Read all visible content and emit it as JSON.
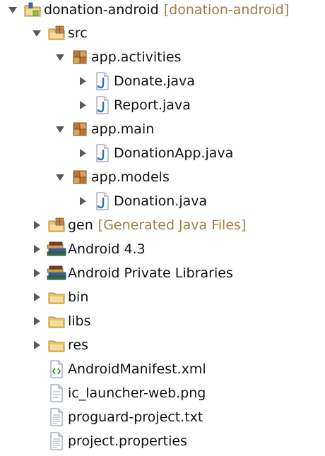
{
  "tree": {
    "project": {
      "label": "donation-android",
      "decoration": "[donation-android]"
    },
    "src": {
      "label": "src"
    },
    "pkg_activities": {
      "label": "app.activities"
    },
    "file_donate": {
      "label": "Donate.java"
    },
    "file_report": {
      "label": "Report.java"
    },
    "pkg_main": {
      "label": "app.main"
    },
    "file_donationapp": {
      "label": "DonationApp.java"
    },
    "pkg_models": {
      "label": "app.models"
    },
    "file_donation": {
      "label": "Donation.java"
    },
    "gen": {
      "label": "gen",
      "decoration": "[Generated Java Files]"
    },
    "android43": {
      "label": "Android 4.3"
    },
    "private_libs": {
      "label": "Android Private Libraries"
    },
    "bin": {
      "label": "bin"
    },
    "libs": {
      "label": "libs"
    },
    "res": {
      "label": "res"
    },
    "manifest": {
      "label": "AndroidManifest.xml"
    },
    "launcher": {
      "label": "ic_launcher-web.png"
    },
    "proguard": {
      "label": "proguard-project.txt"
    },
    "properties": {
      "label": "project.properties"
    }
  },
  "colors": {
    "decoration": "#a07c45",
    "twisty": "#5a5a5a",
    "package": "#b8763a",
    "java_file": "#2e6fc0",
    "folder": "#e8c36a"
  }
}
